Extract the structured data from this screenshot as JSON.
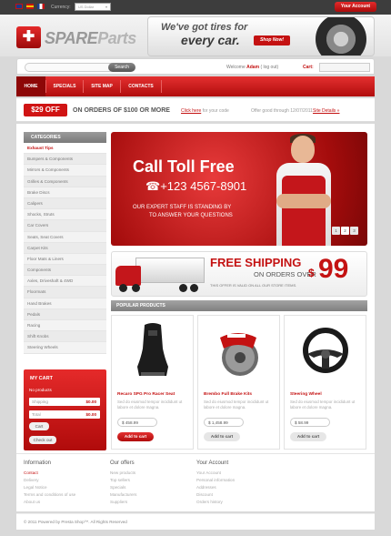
{
  "topbar": {
    "currency_label": "Currency:",
    "currency_value": "US Dollar",
    "account_button": "Your Account",
    "flags": [
      "uk-flag",
      "spain-flag",
      "france-flag"
    ]
  },
  "header": {
    "logo_spare": "SPARE",
    "logo_parts": "Parts",
    "banner_line1": "We've got tires for",
    "banner_line2": "every car.",
    "shop_now": "Shop Now!"
  },
  "searchbar": {
    "search_button": "Search",
    "welcome_prefix": "Welcome",
    "user": "Adam",
    "logout": "( log out)",
    "cart_label": "Cart:"
  },
  "nav": {
    "items": [
      "HOME",
      "SPECIALS",
      "SITE MAP",
      "CONTACTS"
    ]
  },
  "promo": {
    "off": "$29 OFF",
    "orders": "ON ORDERS OF $100 OR MORE",
    "code_link": "Click here",
    "code_text": "for your code",
    "valid": "Offer good through 12/07/2011",
    "details": "Site Details »"
  },
  "categories": {
    "heading": "CATEGORIES",
    "items": [
      "Exhaust Tips",
      "Bumpers & Components",
      "Mirrors & Components",
      "Grilles & Components",
      "Brake Discs",
      "Calipers",
      "Shocks, Struts",
      "Car Covers",
      "Seats, Seat Covers",
      "Carpet Kits",
      "Floor Mats & Liners",
      "Components",
      "Axles, Driveshaft & 4WD",
      "Floormats",
      "Hand Brakes",
      "Pedals",
      "Racing",
      "Shift Knobs",
      "Steering Wheels"
    ]
  },
  "mycart": {
    "heading": "MY CART",
    "no_products": "No products",
    "shipping_label": "Shipping",
    "shipping_value": "$0.00",
    "total_label": "Total",
    "total_value": "$0.00",
    "cart_button": "Cart",
    "checkout_button": "Check out"
  },
  "slider": {
    "call": "Call Toll Free",
    "phone": "+123 4567-8901",
    "staff_line1": "OUR EXPERT STAFF IS STANDING BY",
    "staff_line2": "TO ANSWER YOUR QUESTIONS",
    "pages": [
      "1",
      "2",
      "3"
    ]
  },
  "shipping": {
    "title": "FREE SHIPPING",
    "orders_over": "ON ORDERS OVER",
    "valid": "THIS OFFER IS VALID ON ALL OUR STORE ITEMS.",
    "dollar": "$",
    "amount": "99"
  },
  "popular": {
    "heading": "POPULAR PRODUCTS",
    "products": [
      {
        "title": "Recaro SPG Pro Racer Seat",
        "desc": "Sed do eiusmod tempor incididunt ut labore et dolore magna.",
        "price": "$ 458.99",
        "button": "Add to cart"
      },
      {
        "title": "Brembo Full Brake Kits",
        "desc": "Sed do eiusmod tempor incididunt ut labore et dolore magna.",
        "price": "$ 1,458.99",
        "button": "Add to cart"
      },
      {
        "title": "Steering Wheel",
        "desc": "Sed do eiusmod tempor incididunt ut labore et dolore magna.",
        "price": "$ 58.99",
        "button": "Add to cart"
      }
    ]
  },
  "footer": {
    "information": {
      "heading": "Information",
      "links": [
        "Contact",
        "Delivery",
        "Legal Notice",
        "Terms and conditions of use",
        "About us"
      ]
    },
    "offers": {
      "heading": "Our offers",
      "links": [
        "New products",
        "Top sellers",
        "Specials",
        "Manufacturers",
        "Suppliers"
      ]
    },
    "account": {
      "heading": "Your Account",
      "links": [
        "Your Account",
        "Personal information",
        "Addresses",
        "Discount",
        "Orders history"
      ]
    },
    "copyright": "© 2011 Powered by Presta Shop™. All Rights Reserved"
  },
  "colors": {
    "brand_red": "#c41212",
    "nav_active": "#8d0707"
  }
}
